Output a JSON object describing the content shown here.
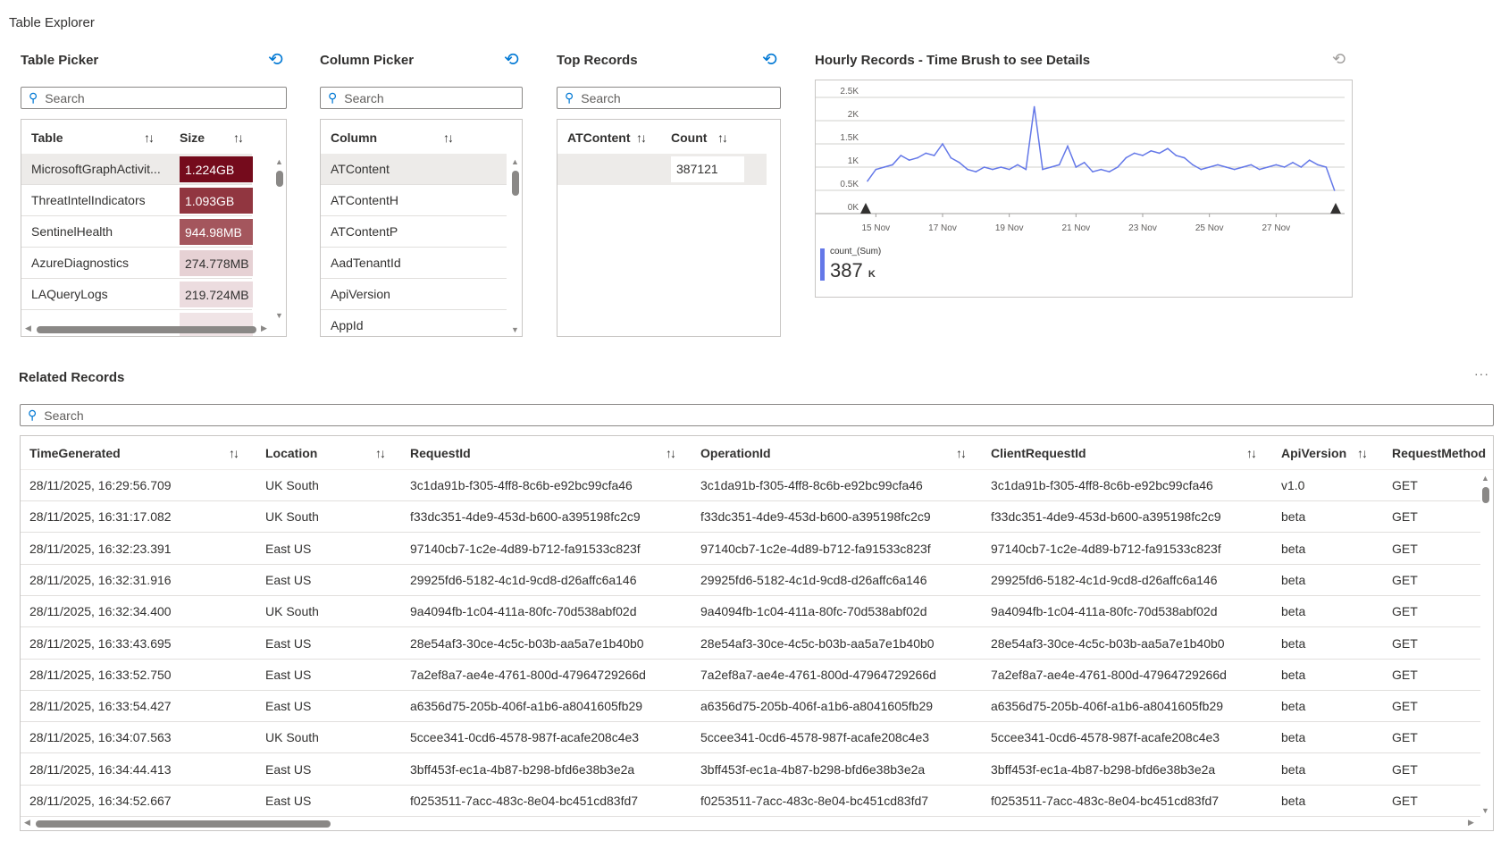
{
  "page_title": "Table Explorer",
  "table_picker": {
    "title": "Table Picker",
    "search_placeholder": "Search",
    "columns": [
      "Table",
      "Size"
    ],
    "rows": [
      {
        "table": "MicrosoftGraphActivit...",
        "size": "1.224GB",
        "color": "#750b1c"
      },
      {
        "table": "ThreatIntelIndicators",
        "size": "1.093GB",
        "color": "#913640"
      },
      {
        "table": "SentinelHealth",
        "size": "944.98MB",
        "color": "#a4565d"
      },
      {
        "table": "AzureDiagnostics",
        "size": "274.778MB",
        "color": "#e6d1d4"
      },
      {
        "table": "LAQueryLogs",
        "size": "219.724MB",
        "color": "#ecdcdf"
      }
    ]
  },
  "column_picker": {
    "title": "Column Picker",
    "search_placeholder": "Search",
    "column": "Column",
    "rows": [
      "ATContent",
      "ATContentH",
      "ATContentP",
      "AadTenantId",
      "ApiVersion",
      "AppId"
    ]
  },
  "top_records": {
    "title": "Top Records",
    "search_placeholder": "Search",
    "columns": [
      "ATContent",
      "Count"
    ],
    "rows": [
      {
        "atcontent": "",
        "count": "387121"
      }
    ]
  },
  "hourly": {
    "title": "Hourly Records - Time Brush to see Details",
    "legend_label": "count_(Sum)",
    "legend_value": "387",
    "legend_unit": "K",
    "series_color": "#6478e8"
  },
  "chart_data": {
    "type": "line",
    "title": "Hourly Records - Time Brush to see Details",
    "y_ticks": [
      "0K",
      "0.5K",
      "1K",
      "1.5K",
      "2K",
      "2.5K"
    ],
    "ylim": [
      0,
      2500
    ],
    "x_ticks": [
      "15 Nov",
      "17 Nov",
      "19 Nov",
      "21 Nov",
      "23 Nov",
      "25 Nov",
      "27 Nov"
    ],
    "grid": true,
    "series": [
      {
        "name": "count_(Sum)",
        "points": [
          [
            "14 Nov 18:00",
            700
          ],
          [
            "15 Nov 00:00",
            950
          ],
          [
            "15 Nov 06:00",
            1000
          ],
          [
            "15 Nov 12:00",
            1050
          ],
          [
            "15 Nov 18:00",
            1250
          ],
          [
            "16 Nov 00:00",
            1150
          ],
          [
            "16 Nov 06:00",
            1200
          ],
          [
            "16 Nov 12:00",
            1300
          ],
          [
            "16 Nov 18:00",
            1250
          ],
          [
            "17 Nov 00:00",
            1500
          ],
          [
            "17 Nov 06:00",
            1200
          ],
          [
            "17 Nov 12:00",
            1100
          ],
          [
            "17 Nov 18:00",
            950
          ],
          [
            "18 Nov 00:00",
            900
          ],
          [
            "18 Nov 06:00",
            1000
          ],
          [
            "18 Nov 12:00",
            950
          ],
          [
            "18 Nov 18:00",
            1000
          ],
          [
            "19 Nov 00:00",
            950
          ],
          [
            "19 Nov 06:00",
            1050
          ],
          [
            "19 Nov 12:00",
            950
          ],
          [
            "19 Nov 18:00",
            2300
          ],
          [
            "20 Nov 00:00",
            950
          ],
          [
            "20 Nov 06:00",
            1000
          ],
          [
            "20 Nov 12:00",
            1050
          ],
          [
            "20 Nov 18:00",
            1450
          ],
          [
            "21 Nov 00:00",
            1000
          ],
          [
            "21 Nov 06:00",
            1100
          ],
          [
            "21 Nov 12:00",
            900
          ],
          [
            "21 Nov 18:00",
            950
          ],
          [
            "22 Nov 00:00",
            900
          ],
          [
            "22 Nov 06:00",
            1000
          ],
          [
            "22 Nov 12:00",
            1200
          ],
          [
            "22 Nov 18:00",
            1300
          ],
          [
            "23 Nov 00:00",
            1250
          ],
          [
            "23 Nov 06:00",
            1350
          ],
          [
            "23 Nov 12:00",
            1300
          ],
          [
            "23 Nov 18:00",
            1400
          ],
          [
            "24 Nov 00:00",
            1250
          ],
          [
            "24 Nov 06:00",
            1200
          ],
          [
            "24 Nov 12:00",
            1050
          ],
          [
            "24 Nov 18:00",
            950
          ],
          [
            "25 Nov 00:00",
            1000
          ],
          [
            "25 Nov 06:00",
            1050
          ],
          [
            "25 Nov 12:00",
            1000
          ],
          [
            "25 Nov 18:00",
            950
          ],
          [
            "26 Nov 00:00",
            1000
          ],
          [
            "26 Nov 06:00",
            1050
          ],
          [
            "26 Nov 12:00",
            950
          ],
          [
            "26 Nov 18:00",
            1000
          ],
          [
            "27 Nov 00:00",
            1050
          ],
          [
            "27 Nov 06:00",
            1000
          ],
          [
            "27 Nov 12:00",
            1100
          ],
          [
            "27 Nov 18:00",
            1000
          ],
          [
            "28 Nov 00:00",
            1150
          ],
          [
            "28 Nov 06:00",
            1050
          ],
          [
            "28 Nov 12:00",
            1000
          ],
          [
            "28 Nov 18:00",
            500
          ]
        ]
      }
    ]
  },
  "related": {
    "title": "Related Records",
    "more": "···",
    "search_placeholder": "Search",
    "columns": [
      "TimeGenerated",
      "Location",
      "RequestId",
      "OperationId",
      "ClientRequestId",
      "ApiVersion",
      "RequestMethod"
    ],
    "rows": [
      [
        "28/11/2025, 16:29:56.709",
        "UK South",
        "3c1da91b-f305-4ff8-8c6b-e92bc99cfa46",
        "3c1da91b-f305-4ff8-8c6b-e92bc99cfa46",
        "3c1da91b-f305-4ff8-8c6b-e92bc99cfa46",
        "v1.0",
        "GET"
      ],
      [
        "28/11/2025, 16:31:17.082",
        "UK South",
        "f33dc351-4de9-453d-b600-a395198fc2c9",
        "f33dc351-4de9-453d-b600-a395198fc2c9",
        "f33dc351-4de9-453d-b600-a395198fc2c9",
        "beta",
        "GET"
      ],
      [
        "28/11/2025, 16:32:23.391",
        "East US",
        "97140cb7-1c2e-4d89-b712-fa91533c823f",
        "97140cb7-1c2e-4d89-b712-fa91533c823f",
        "97140cb7-1c2e-4d89-b712-fa91533c823f",
        "beta",
        "GET"
      ],
      [
        "28/11/2025, 16:32:31.916",
        "East US",
        "29925fd6-5182-4c1d-9cd8-d26affc6a146",
        "29925fd6-5182-4c1d-9cd8-d26affc6a146",
        "29925fd6-5182-4c1d-9cd8-d26affc6a146",
        "beta",
        "GET"
      ],
      [
        "28/11/2025, 16:32:34.400",
        "UK South",
        "9a4094fb-1c04-411a-80fc-70d538abf02d",
        "9a4094fb-1c04-411a-80fc-70d538abf02d",
        "9a4094fb-1c04-411a-80fc-70d538abf02d",
        "beta",
        "GET"
      ],
      [
        "28/11/2025, 16:33:43.695",
        "East US",
        "28e54af3-30ce-4c5c-b03b-aa5a7e1b40b0",
        "28e54af3-30ce-4c5c-b03b-aa5a7e1b40b0",
        "28e54af3-30ce-4c5c-b03b-aa5a7e1b40b0",
        "beta",
        "GET"
      ],
      [
        "28/11/2025, 16:33:52.750",
        "East US",
        "7a2ef8a7-ae4e-4761-800d-47964729266d",
        "7a2ef8a7-ae4e-4761-800d-47964729266d",
        "7a2ef8a7-ae4e-4761-800d-47964729266d",
        "beta",
        "GET"
      ],
      [
        "28/11/2025, 16:33:54.427",
        "East US",
        "a6356d75-205b-406f-a1b6-a8041605fb29",
        "a6356d75-205b-406f-a1b6-a8041605fb29",
        "a6356d75-205b-406f-a1b6-a8041605fb29",
        "beta",
        "GET"
      ],
      [
        "28/11/2025, 16:34:07.563",
        "UK South",
        "5ccee341-0cd6-4578-987f-acafe208c4e3",
        "5ccee341-0cd6-4578-987f-acafe208c4e3",
        "5ccee341-0cd6-4578-987f-acafe208c4e3",
        "beta",
        "GET"
      ],
      [
        "28/11/2025, 16:34:44.413",
        "East US",
        "3bff453f-ec1a-4b87-b298-bfd6e38b3e2a",
        "3bff453f-ec1a-4b87-b298-bfd6e38b3e2a",
        "3bff453f-ec1a-4b87-b298-bfd6e38b3e2a",
        "beta",
        "GET"
      ],
      [
        "28/11/2025, 16:34:52.667",
        "East US",
        "f0253511-7acc-483c-8e04-bc451cd83fd7",
        "f0253511-7acc-483c-8e04-bc451cd83fd7",
        "f0253511-7acc-483c-8e04-bc451cd83fd7",
        "beta",
        "GET"
      ]
    ]
  }
}
